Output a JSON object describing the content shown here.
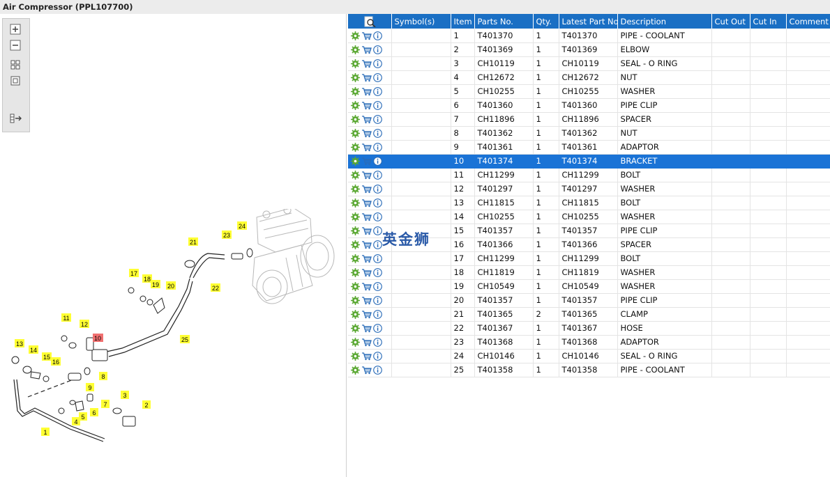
{
  "window": {
    "title": "Air Compressor (PPL107700)"
  },
  "toolbar": {
    "buttons": [
      "zoom-in",
      "zoom-out",
      "fit-all",
      "fit-window",
      "export"
    ]
  },
  "table": {
    "headers": [
      "",
      "Symbol(s)",
      "Item",
      "Parts No.",
      "Qty.",
      "Latest Part No.",
      "Description",
      "Cut Out",
      "Cut In",
      "Comment"
    ],
    "selected_item": "10",
    "rows": [
      {
        "item": "1",
        "part": "T401370",
        "qty": "1",
        "latest": "T401370",
        "desc": "PIPE - COOLANT"
      },
      {
        "item": "2",
        "part": "T401369",
        "qty": "1",
        "latest": "T401369",
        "desc": "ELBOW"
      },
      {
        "item": "3",
        "part": "CH10119",
        "qty": "1",
        "latest": "CH10119",
        "desc": "SEAL - O RING"
      },
      {
        "item": "4",
        "part": "CH12672",
        "qty": "1",
        "latest": "CH12672",
        "desc": "NUT"
      },
      {
        "item": "5",
        "part": "CH10255",
        "qty": "1",
        "latest": "CH10255",
        "desc": "WASHER"
      },
      {
        "item": "6",
        "part": "T401360",
        "qty": "1",
        "latest": "T401360",
        "desc": "PIPE CLIP"
      },
      {
        "item": "7",
        "part": "CH11896",
        "qty": "1",
        "latest": "CH11896",
        "desc": "SPACER"
      },
      {
        "item": "8",
        "part": "T401362",
        "qty": "1",
        "latest": "T401362",
        "desc": "NUT"
      },
      {
        "item": "9",
        "part": "T401361",
        "qty": "1",
        "latest": "T401361",
        "desc": "ADAPTOR"
      },
      {
        "item": "10",
        "part": "T401374",
        "qty": "1",
        "latest": "T401374",
        "desc": "BRACKET"
      },
      {
        "item": "11",
        "part": "CH11299",
        "qty": "1",
        "latest": "CH11299",
        "desc": "BOLT"
      },
      {
        "item": "12",
        "part": "T401297",
        "qty": "1",
        "latest": "T401297",
        "desc": "WASHER"
      },
      {
        "item": "13",
        "part": "CH11815",
        "qty": "1",
        "latest": "CH11815",
        "desc": "BOLT"
      },
      {
        "item": "14",
        "part": "CH10255",
        "qty": "1",
        "latest": "CH10255",
        "desc": "WASHER"
      },
      {
        "item": "15",
        "part": "T401357",
        "qty": "1",
        "latest": "T401357",
        "desc": "PIPE CLIP"
      },
      {
        "item": "16",
        "part": "T401366",
        "qty": "1",
        "latest": "T401366",
        "desc": "SPACER"
      },
      {
        "item": "17",
        "part": "CH11299",
        "qty": "1",
        "latest": "CH11299",
        "desc": "BOLT"
      },
      {
        "item": "18",
        "part": "CH11819",
        "qty": "1",
        "latest": "CH11819",
        "desc": "WASHER"
      },
      {
        "item": "19",
        "part": "CH10549",
        "qty": "1",
        "latest": "CH10549",
        "desc": "WASHER"
      },
      {
        "item": "20",
        "part": "T401357",
        "qty": "1",
        "latest": "T401357",
        "desc": "PIPE CLIP"
      },
      {
        "item": "21",
        "part": "T401365",
        "qty": "2",
        "latest": "T401365",
        "desc": "CLAMP"
      },
      {
        "item": "22",
        "part": "T401367",
        "qty": "1",
        "latest": "T401367",
        "desc": "HOSE"
      },
      {
        "item": "23",
        "part": "T401368",
        "qty": "1",
        "latest": "T401368",
        "desc": "ADAPTOR"
      },
      {
        "item": "24",
        "part": "CH10146",
        "qty": "1",
        "latest": "CH10146",
        "desc": "SEAL - O RING"
      },
      {
        "item": "25",
        "part": "T401358",
        "qty": "1",
        "latest": "T401358",
        "desc": "PIPE - COOLANT"
      }
    ]
  },
  "diagram": {
    "highlight_color": "#f07070",
    "callout_color": "#ffff33",
    "callouts": [
      "1",
      "2",
      "3",
      "4",
      "5",
      "6",
      "7",
      "8",
      "9",
      "10",
      "11",
      "12",
      "13",
      "14",
      "15",
      "16",
      "17",
      "18",
      "19",
      "20",
      "21",
      "22",
      "23",
      "24",
      "25"
    ]
  },
  "watermark": {
    "text": "英金狮"
  },
  "colors": {
    "header_bg": "#1a6fc4",
    "selected_bg": "#1a73d6"
  }
}
